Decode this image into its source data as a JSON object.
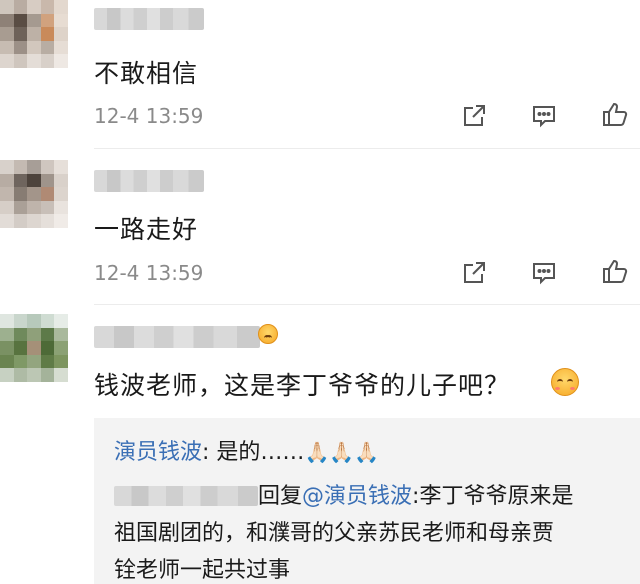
{
  "comments": [
    {
      "text": "不敢相信",
      "time": "12-4 13:59"
    },
    {
      "text": "一路走好",
      "time": "12-4 13:59"
    },
    {
      "text": "钱波老师，这是李丁爷爷的儿子吧？"
    }
  ],
  "replies": {
    "first": {
      "author": "演员钱波",
      "sep": ": ",
      "text": "是的……",
      "emoji": "🙏🏻🙏🏻🙏🏻"
    },
    "second": {
      "prefix": "回复",
      "mention": "@演员钱波",
      "line1": ":李丁爷爷原来是",
      "line2": "祖国剧团的，和濮哥的父亲苏民老师和母亲贾",
      "line3": "铨老师一起共过事"
    }
  },
  "icons": [
    "repost-icon",
    "comment-icon",
    "like-icon"
  ],
  "colors": {
    "link": "#3a6fb5",
    "time": "#8a8a8a",
    "reply_bg": "#f3f3f3"
  }
}
